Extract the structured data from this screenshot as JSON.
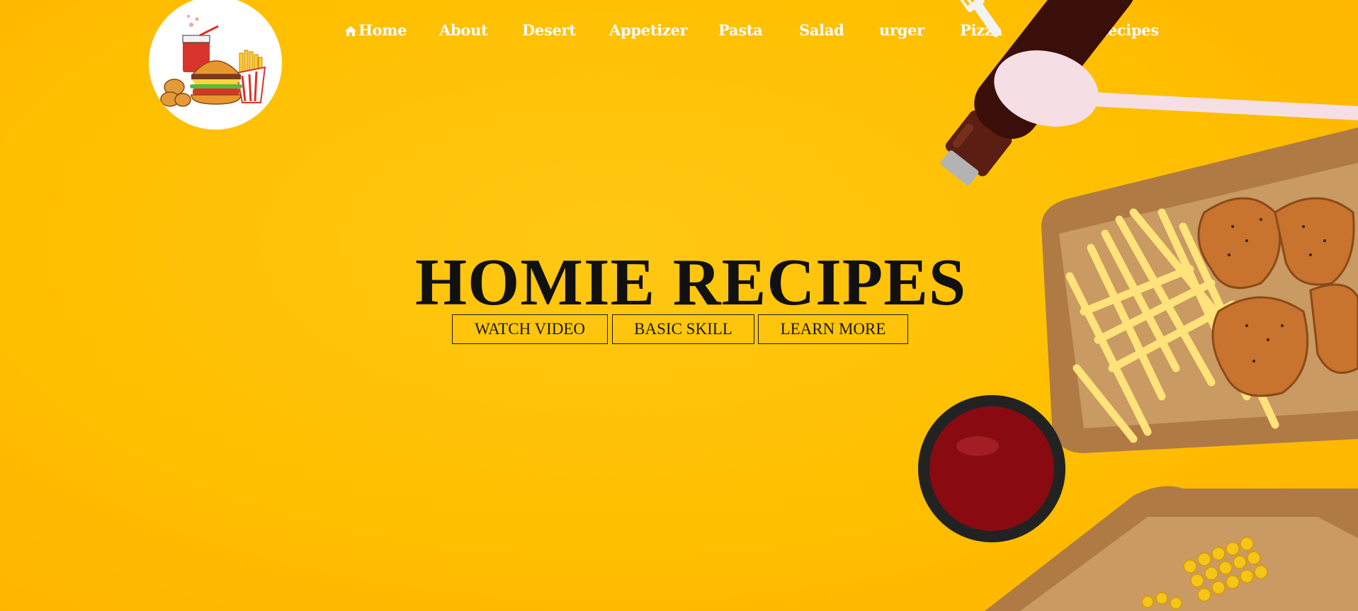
{
  "logo": {
    "alt": "homie-recipes-logo",
    "icon": "fast-food-icon"
  },
  "nav": {
    "items": [
      {
        "label": "Home",
        "icon": "home-icon"
      },
      {
        "label": "About"
      },
      {
        "label": "Desert"
      },
      {
        "label": "Appetizer"
      },
      {
        "label": "Pasta"
      },
      {
        "label": "Salad"
      },
      {
        "label": "urger"
      },
      {
        "label": "Pizza"
      },
      {
        "label": "More Recipes",
        "icon": "caret-down-icon"
      }
    ]
  },
  "hero": {
    "title": "HOMIE RECIPES",
    "buttons": [
      {
        "label": "WATCH VIDEO"
      },
      {
        "label": "BASIC SKILL"
      },
      {
        "label": "LEARN MORE"
      }
    ]
  },
  "colors": {
    "background": "#ffbf00",
    "nav_text": "#ffffff",
    "title_text": "#111111"
  }
}
